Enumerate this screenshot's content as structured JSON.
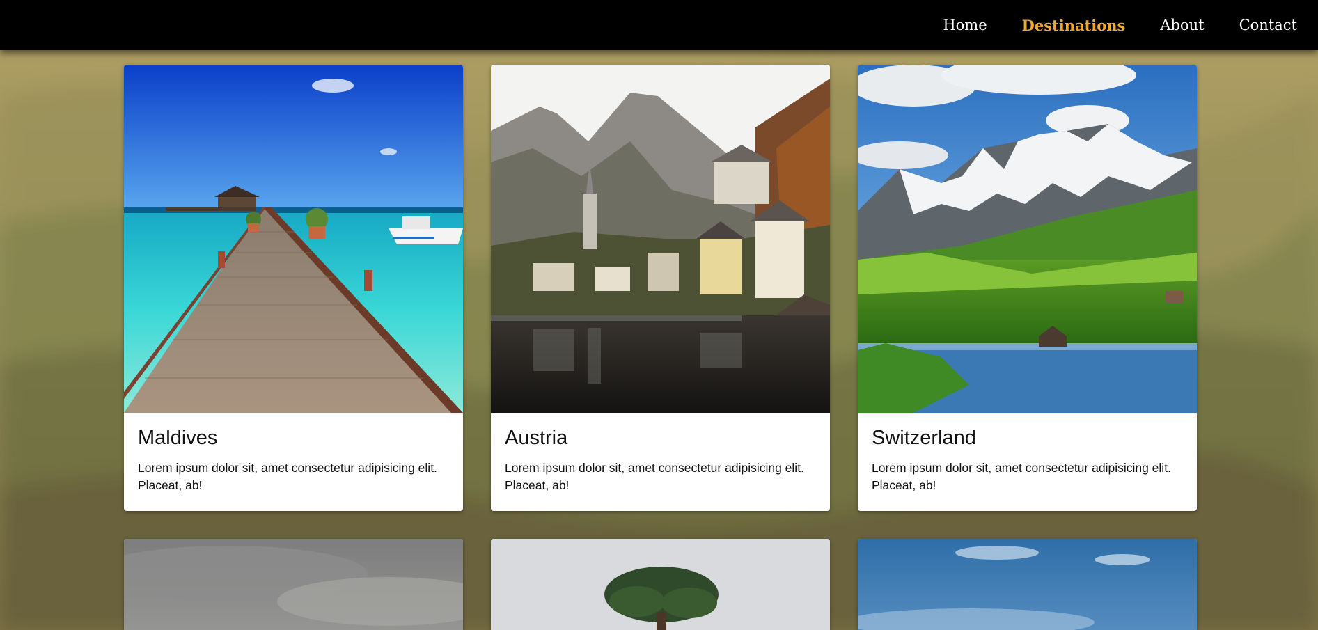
{
  "nav": {
    "links": [
      {
        "label": "Home",
        "active": false
      },
      {
        "label": "Destinations",
        "active": true
      },
      {
        "label": "About",
        "active": false
      },
      {
        "label": "Contact",
        "active": false
      }
    ],
    "active_color": "#f0a92e"
  },
  "cards": [
    {
      "title": "Maldives",
      "text": "Lorem ipsum dolor sit, amet consectetur adipisicing elit. Placeat, ab!",
      "image": "tropical-pier-image"
    },
    {
      "title": "Austria",
      "text": "Lorem ipsum dolor sit, amet consectetur adipisicing elit. Placeat, ab!",
      "image": "alpine-village-lake-image"
    },
    {
      "title": "Switzerland",
      "text": "Lorem ipsum dolor sit, amet consectetur adipisicing elit. Placeat, ab!",
      "image": "snowy-mountains-meadow-image"
    },
    {
      "image": "cloudy-sky-hills-image"
    },
    {
      "image": "lone-tree-image"
    },
    {
      "image": "blue-sky-image"
    }
  ]
}
